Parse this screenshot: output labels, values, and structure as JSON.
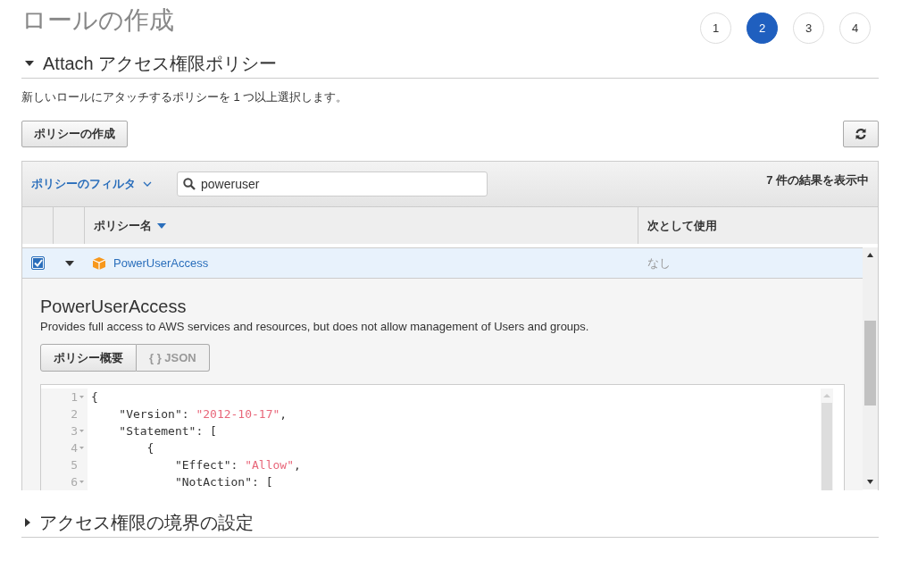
{
  "page_title": "ロールの作成",
  "steps": [
    {
      "label": "1",
      "selected": false
    },
    {
      "label": "2",
      "selected": true
    },
    {
      "label": "3",
      "selected": false
    },
    {
      "label": "4",
      "selected": false
    }
  ],
  "sections": [
    {
      "title": "Attach アクセス権限ポリシー",
      "expanded": true
    },
    {
      "title": "アクセス権限の境界の設定",
      "expanded": false
    }
  ],
  "description": "新しいロールにアタッチするポリシーを 1 つ以上選択します。",
  "create_policy_button": "ポリシーの作成",
  "filter_menu": "ポリシーのフィルタ",
  "search": {
    "value": "poweruser"
  },
  "result_count": "7 件の結果を表示中",
  "table": {
    "columns": [
      {
        "label": "ポリシー名",
        "sorted": true
      },
      {
        "label": "次として使用",
        "sorted": false
      }
    ],
    "rows": [
      {
        "checked": true,
        "expanded": true,
        "name": "PowerUserAccess",
        "used_as": "なし"
      }
    ]
  },
  "detail": {
    "title": "PowerUserAccess",
    "description": "Provides full access to AWS services and resources, but does not allow management of Users and groups.",
    "tabs": [
      {
        "label": "ポリシー概要",
        "selected": true
      },
      {
        "label": "{ } JSON",
        "selected": false
      }
    ],
    "code_lines": [
      {
        "number": "1",
        "foldable": true,
        "parts": [
          {
            "kind": "plain",
            "text": "{"
          }
        ]
      },
      {
        "number": "2",
        "foldable": false,
        "parts": [
          {
            "kind": "plain",
            "text": "    \"Version\": "
          },
          {
            "kind": "string",
            "text": "\"2012-10-17\""
          },
          {
            "kind": "plain",
            "text": ","
          }
        ]
      },
      {
        "number": "3",
        "foldable": true,
        "parts": [
          {
            "kind": "plain",
            "text": "    \"Statement\": ["
          }
        ]
      },
      {
        "number": "4",
        "foldable": true,
        "parts": [
          {
            "kind": "plain",
            "text": "        {"
          }
        ]
      },
      {
        "number": "5",
        "foldable": false,
        "parts": [
          {
            "kind": "plain",
            "text": "            \"Effect\": "
          },
          {
            "kind": "string",
            "text": "\"Allow\""
          },
          {
            "kind": "plain",
            "text": ","
          }
        ]
      },
      {
        "number": "6",
        "foldable": true,
        "parts": [
          {
            "kind": "plain",
            "text": "            \"NotAction\": ["
          }
        ]
      }
    ]
  }
}
